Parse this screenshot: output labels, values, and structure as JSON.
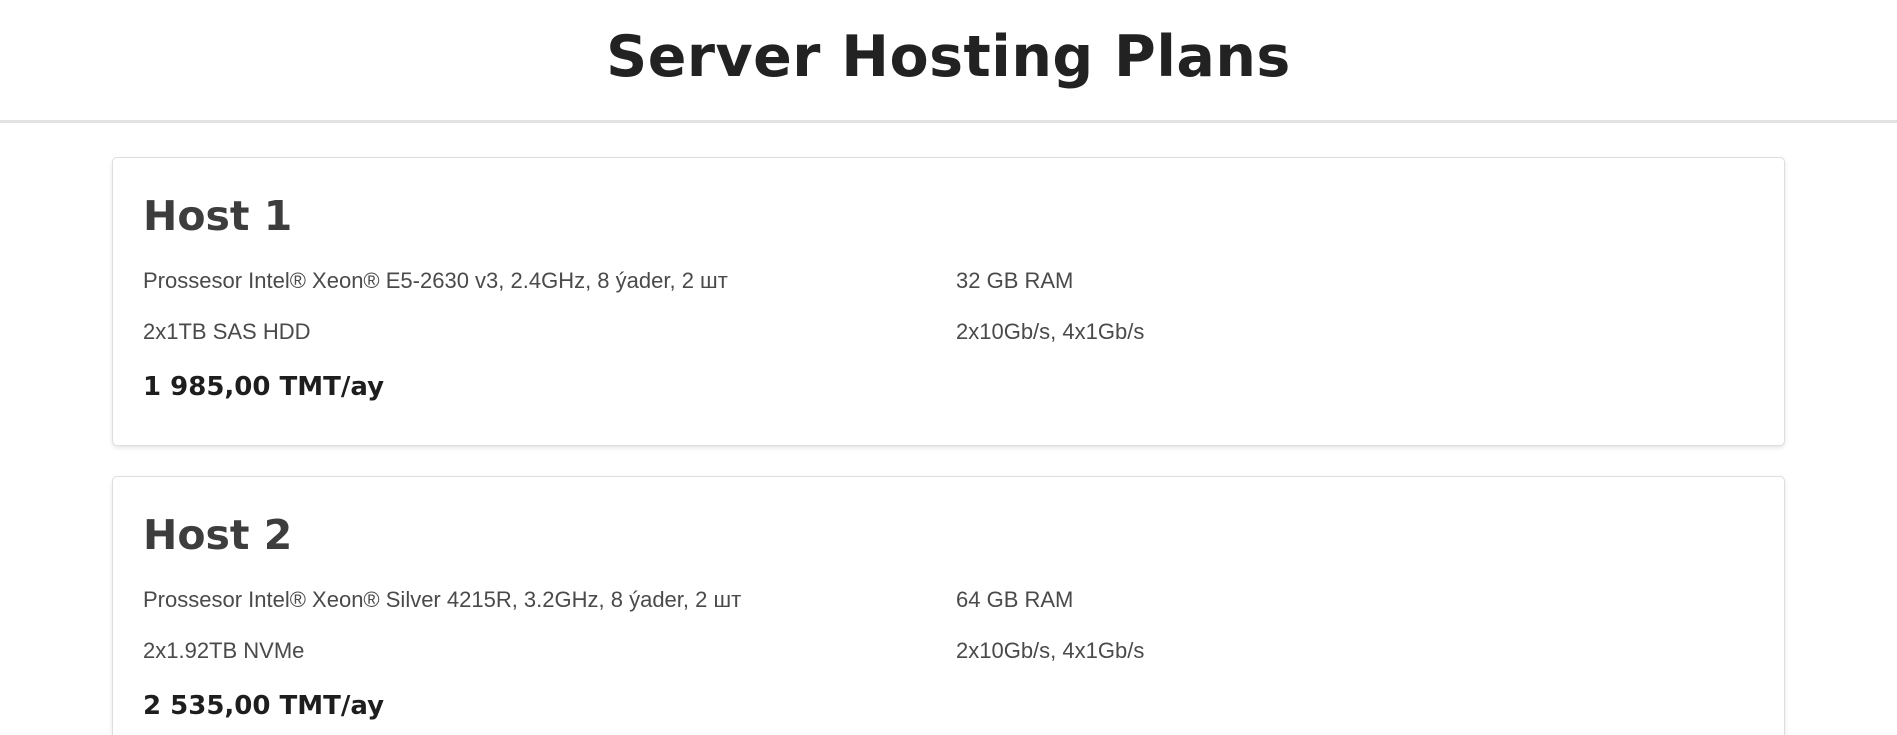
{
  "page": {
    "title": "Server Hosting Plans"
  },
  "plans": [
    {
      "name": "Host 1",
      "cpu": "Prossesor Intel® Xeon® E5-2630 v3, 2.4GHz, 8 ýader, 2 шт",
      "ram": "32 GB RAM",
      "storage": "2x1TB SAS HDD",
      "network": "2x10Gb/s, 4x1Gb/s",
      "price": "1 985,00 TMT/ay"
    },
    {
      "name": "Host 2",
      "cpu": "Prossesor Intel® Xeon® Silver 4215R, 3.2GHz, 8 ýader, 2 шт",
      "ram": "64 GB RAM",
      "storage": "2x1.92TB NVMe",
      "network": "2x10Gb/s, 4x1Gb/s",
      "price": "2 535,00 TMT/ay"
    }
  ]
}
